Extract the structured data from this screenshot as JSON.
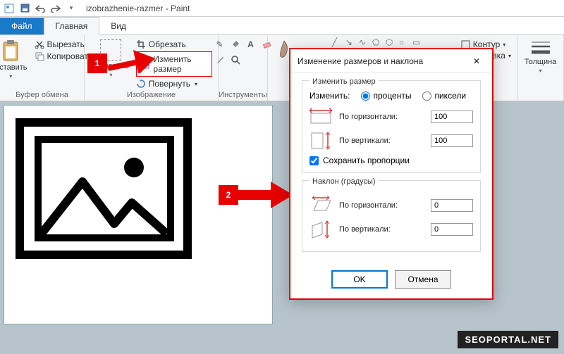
{
  "qat": {
    "title": "izobrazhenie-razmer - Paint"
  },
  "tabs": {
    "file": "Файл",
    "home": "Главная",
    "view": "Вид"
  },
  "ribbon": {
    "paste": "Вставить",
    "cut": "Вырезать",
    "copy": "Копировать",
    "clipboard_group": "Буфер обмена",
    "select": "Выделить",
    "crop": "Обрезать",
    "resize": "Изменить размер",
    "rotate": "Повернуть",
    "image_group": "Изображение",
    "tools_group": "Инструменты",
    "outline": "Контур",
    "fill": "Заливка",
    "thickness": "Толщина"
  },
  "callouts": {
    "one": "1",
    "two": "2"
  },
  "dialog": {
    "title": "Изменение размеров и наклона",
    "resize_legend": "Изменить размер",
    "by_label": "Изменить:",
    "percent": "проценты",
    "pixels": "пиксели",
    "horizontal": "По горизонтали:",
    "vertical": "По вертикали:",
    "h_value": "100",
    "v_value": "100",
    "keep_aspect": "Сохранить пропорции",
    "skew_legend": "Наклон (градусы)",
    "skew_h": "0",
    "skew_v": "0",
    "ok": "OK",
    "cancel": "Отмена"
  },
  "watermark": "SEOPORTAL.NET"
}
